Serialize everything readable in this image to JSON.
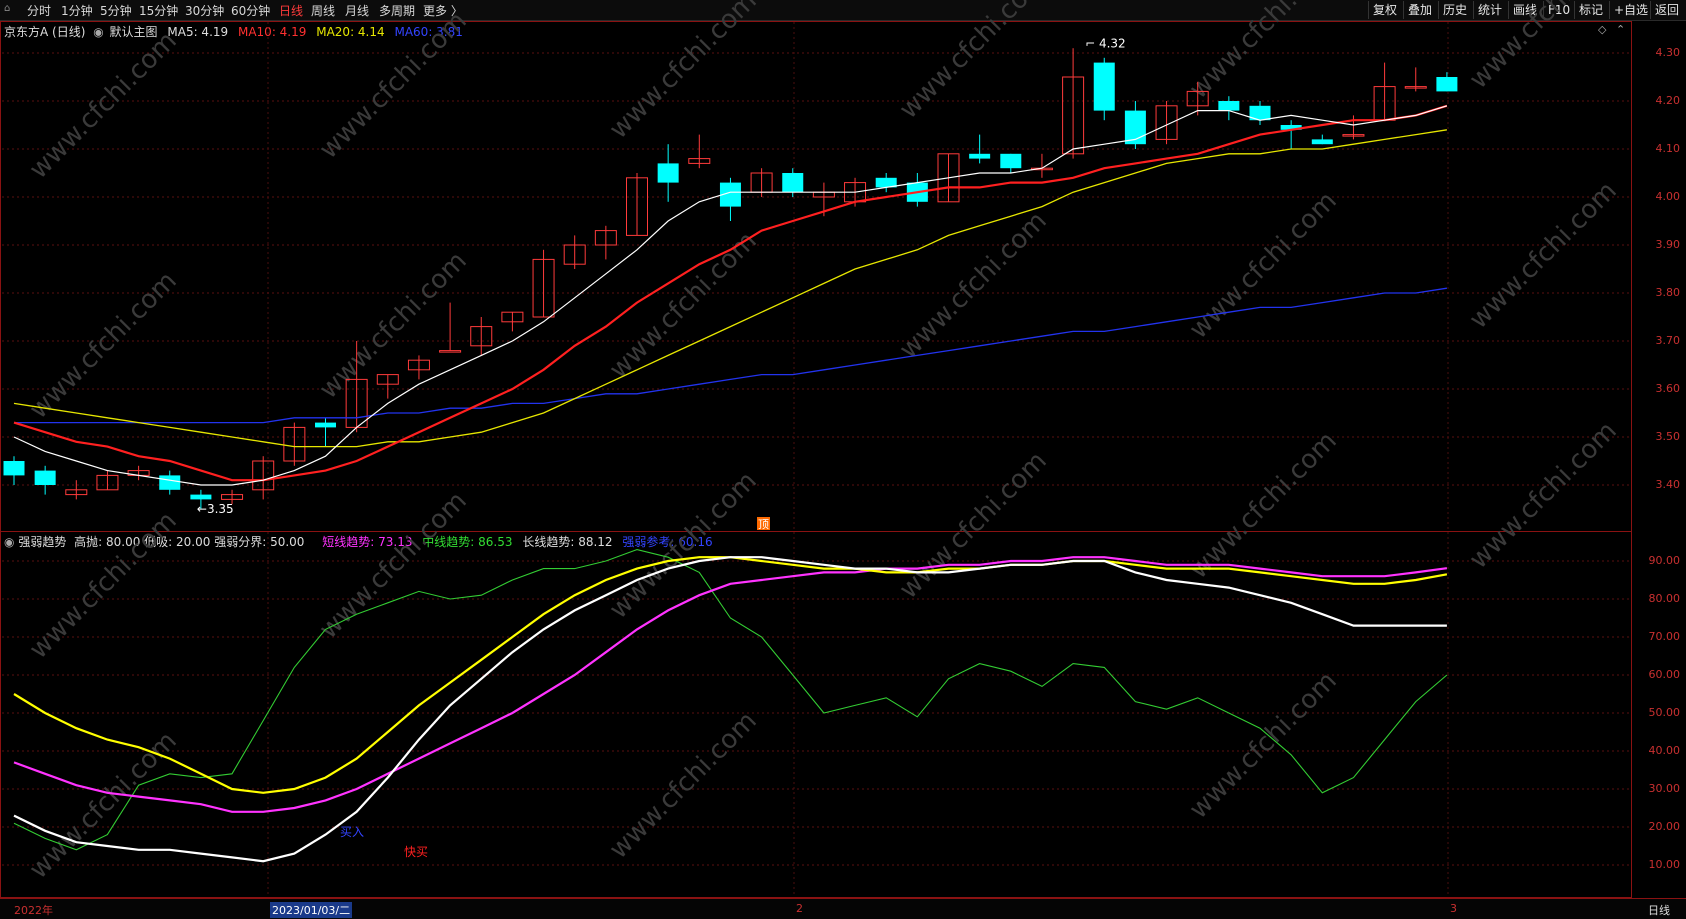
{
  "toolbar": {
    "periods": [
      "分时",
      "1分钟",
      "5分钟",
      "15分钟",
      "30分钟",
      "60分钟",
      "日线",
      "周线",
      "月线",
      "多周期",
      "更多 〉"
    ],
    "active_period": "日线",
    "right_buttons": [
      "复权",
      "叠加",
      "历史",
      "统计",
      "画线",
      "F10",
      "标记",
      "+自选",
      "返回"
    ]
  },
  "price_info": {
    "stock_name": "京东方A (日线)",
    "chart_name": "默认主图",
    "ma5": "MA5: 4.19",
    "ma10": "MA10: 4.19",
    "ma20": "MA20: 4.14",
    "ma60": "MA60: 3.81"
  },
  "indicator_info": {
    "name": "强弱趋势",
    "params": "高抛: 80.00  低吸: 20.00  强弱分界: 50.00",
    "short": "短线趋势: 73.13",
    "mid": "中线趋势: 86.53",
    "long": "长线趋势: 88.12",
    "ref": "强弱参考: 60.16"
  },
  "annotations": {
    "high": "4.32",
    "low": "3.35",
    "buy1": "买入",
    "buy2": "快买",
    "top_mark": "顶"
  },
  "watermark": "www.cfchi.com",
  "price_axis": [
    "4.30",
    "4.20",
    "4.10",
    "4.00",
    "3.90",
    "3.80",
    "3.70",
    "3.60",
    "3.50",
    "3.40"
  ],
  "ind_axis": [
    "90.00",
    "80.00",
    "70.00",
    "60.00",
    "50.00",
    "40.00",
    "30.00",
    "20.00",
    "10.00"
  ],
  "time_axis": {
    "start": "2022年",
    "cursor": "2023/01/03/二",
    "m2": "2",
    "m3": "3",
    "period": "日线"
  },
  "colors": {
    "up": "#ff3b3b",
    "down": "#00ffff",
    "ma5": "#ffffff",
    "ma10": "#ff2020",
    "ma20": "#e6e600",
    "ma60": "#2233ee",
    "short": "#ffffff",
    "mid": "#ffff00",
    "long": "#ff33ff",
    "ref": "#33cc33"
  },
  "chart_data": {
    "type": "candlestick",
    "candles": [
      {
        "o": 3.45,
        "h": 3.46,
        "l": 3.4,
        "c": 3.42
      },
      {
        "o": 3.43,
        "h": 3.44,
        "l": 3.38,
        "c": 3.4
      },
      {
        "o": 3.38,
        "h": 3.41,
        "l": 3.37,
        "c": 3.39
      },
      {
        "o": 3.39,
        "h": 3.43,
        "l": 3.39,
        "c": 3.42
      },
      {
        "o": 3.42,
        "h": 3.44,
        "l": 3.41,
        "c": 3.43
      },
      {
        "o": 3.42,
        "h": 3.43,
        "l": 3.38,
        "c": 3.39
      },
      {
        "o": 3.38,
        "h": 3.39,
        "l": 3.35,
        "c": 3.37
      },
      {
        "o": 3.37,
        "h": 3.39,
        "l": 3.36,
        "c": 3.38
      },
      {
        "o": 3.39,
        "h": 3.46,
        "l": 3.37,
        "c": 3.45
      },
      {
        "o": 3.45,
        "h": 3.53,
        "l": 3.44,
        "c": 3.52
      },
      {
        "o": 3.53,
        "h": 3.54,
        "l": 3.48,
        "c": 3.52
      },
      {
        "o": 3.52,
        "h": 3.7,
        "l": 3.51,
        "c": 3.62
      },
      {
        "o": 3.61,
        "h": 3.63,
        "l": 3.58,
        "c": 3.63
      },
      {
        "o": 3.64,
        "h": 3.67,
        "l": 3.62,
        "c": 3.66
      },
      {
        "o": 3.68,
        "h": 3.78,
        "l": 3.68,
        "c": 3.68
      },
      {
        "o": 3.69,
        "h": 3.75,
        "l": 3.67,
        "c": 3.73
      },
      {
        "o": 3.74,
        "h": 3.76,
        "l": 3.72,
        "c": 3.76
      },
      {
        "o": 3.75,
        "h": 3.89,
        "l": 3.75,
        "c": 3.87
      },
      {
        "o": 3.86,
        "h": 3.92,
        "l": 3.85,
        "c": 3.9
      },
      {
        "o": 3.9,
        "h": 3.94,
        "l": 3.87,
        "c": 3.93
      },
      {
        "o": 3.92,
        "h": 4.05,
        "l": 3.92,
        "c": 4.04
      },
      {
        "o": 4.07,
        "h": 4.11,
        "l": 3.99,
        "c": 4.03
      },
      {
        "o": 4.07,
        "h": 4.13,
        "l": 4.06,
        "c": 4.08
      },
      {
        "o": 4.03,
        "h": 4.04,
        "l": 3.95,
        "c": 3.98
      },
      {
        "o": 4.01,
        "h": 4.06,
        "l": 4.0,
        "c": 4.05
      },
      {
        "o": 4.05,
        "h": 4.06,
        "l": 4.0,
        "c": 4.01
      },
      {
        "o": 4.0,
        "h": 4.03,
        "l": 3.96,
        "c": 4.01
      },
      {
        "o": 3.99,
        "h": 4.04,
        "l": 3.98,
        "c": 4.03
      },
      {
        "o": 4.04,
        "h": 4.05,
        "l": 4.01,
        "c": 4.02
      },
      {
        "o": 4.03,
        "h": 4.05,
        "l": 3.98,
        "c": 3.99
      },
      {
        "o": 3.99,
        "h": 4.09,
        "l": 3.99,
        "c": 4.09
      },
      {
        "o": 4.09,
        "h": 4.13,
        "l": 4.07,
        "c": 4.08
      },
      {
        "o": 4.09,
        "h": 4.09,
        "l": 4.05,
        "c": 4.06
      },
      {
        "o": 4.06,
        "h": 4.09,
        "l": 4.04,
        "c": 4.06
      },
      {
        "o": 4.09,
        "h": 4.31,
        "l": 4.08,
        "c": 4.25
      },
      {
        "o": 4.28,
        "h": 4.29,
        "l": 4.16,
        "c": 4.18
      },
      {
        "o": 4.18,
        "h": 4.2,
        "l": 4.1,
        "c": 4.11
      },
      {
        "o": 4.12,
        "h": 4.2,
        "l": 4.11,
        "c": 4.19
      },
      {
        "o": 4.19,
        "h": 4.24,
        "l": 4.17,
        "c": 4.22
      },
      {
        "o": 4.2,
        "h": 4.21,
        "l": 4.16,
        "c": 4.18
      },
      {
        "o": 4.19,
        "h": 4.2,
        "l": 4.15,
        "c": 4.16
      },
      {
        "o": 4.15,
        "h": 4.16,
        "l": 4.1,
        "c": 4.14
      },
      {
        "o": 4.12,
        "h": 4.13,
        "l": 4.11,
        "c": 4.11
      },
      {
        "o": 4.13,
        "h": 4.17,
        "l": 4.12,
        "c": 4.13
      },
      {
        "o": 4.16,
        "h": 4.28,
        "l": 4.16,
        "c": 4.23
      },
      {
        "o": 4.23,
        "h": 4.27,
        "l": 4.22,
        "c": 4.23
      },
      {
        "o": 4.25,
        "h": 4.26,
        "l": 4.22,
        "c": 4.22
      }
    ],
    "ma5": [
      3.5,
      3.47,
      3.45,
      3.43,
      3.42,
      3.41,
      3.4,
      3.4,
      3.41,
      3.43,
      3.46,
      3.52,
      3.57,
      3.61,
      3.64,
      3.67,
      3.7,
      3.74,
      3.79,
      3.84,
      3.89,
      3.95,
      3.99,
      4.01,
      4.01,
      4.01,
      4.01,
      4.01,
      4.02,
      4.03,
      4.04,
      4.05,
      4.05,
      4.06,
      4.1,
      4.11,
      4.12,
      4.15,
      4.18,
      4.18,
      4.16,
      4.17,
      4.16,
      4.15,
      4.16,
      4.17,
      4.19
    ],
    "ma10": [
      3.53,
      3.51,
      3.49,
      3.48,
      3.46,
      3.45,
      3.43,
      3.41,
      3.41,
      3.42,
      3.43,
      3.45,
      3.48,
      3.51,
      3.54,
      3.57,
      3.6,
      3.64,
      3.69,
      3.73,
      3.78,
      3.82,
      3.86,
      3.89,
      3.93,
      3.95,
      3.97,
      3.99,
      4.0,
      4.01,
      4.02,
      4.02,
      4.03,
      4.03,
      4.04,
      4.06,
      4.07,
      4.08,
      4.09,
      4.11,
      4.13,
      4.14,
      4.15,
      4.16,
      4.16,
      4.17,
      4.19
    ],
    "ma20": [
      3.57,
      3.56,
      3.55,
      3.54,
      3.53,
      3.52,
      3.51,
      3.5,
      3.49,
      3.48,
      3.48,
      3.48,
      3.49,
      3.49,
      3.5,
      3.51,
      3.53,
      3.55,
      3.58,
      3.61,
      3.64,
      3.67,
      3.7,
      3.73,
      3.76,
      3.79,
      3.82,
      3.85,
      3.87,
      3.89,
      3.92,
      3.94,
      3.96,
      3.98,
      4.01,
      4.03,
      4.05,
      4.07,
      4.08,
      4.09,
      4.09,
      4.1,
      4.1,
      4.11,
      4.12,
      4.13,
      4.14
    ],
    "ma60": [
      3.53,
      3.53,
      3.53,
      3.53,
      3.53,
      3.53,
      3.53,
      3.53,
      3.53,
      3.54,
      3.54,
      3.54,
      3.55,
      3.55,
      3.56,
      3.56,
      3.57,
      3.57,
      3.58,
      3.59,
      3.59,
      3.6,
      3.61,
      3.62,
      3.63,
      3.63,
      3.64,
      3.65,
      3.66,
      3.67,
      3.68,
      3.69,
      3.7,
      3.71,
      3.72,
      3.72,
      3.73,
      3.74,
      3.75,
      3.76,
      3.77,
      3.77,
      3.78,
      3.79,
      3.8,
      3.8,
      3.81
    ],
    "short_trend": [
      23,
      19,
      16,
      15,
      14,
      14,
      13,
      12,
      11,
      13,
      18,
      24,
      33,
      43,
      52,
      59,
      66,
      72,
      77,
      81,
      85,
      88,
      90,
      91,
      91,
      90,
      89,
      88,
      88,
      87,
      87,
      88,
      89,
      89,
      90,
      90,
      87,
      85,
      84,
      83,
      81,
      79,
      76,
      73,
      73,
      73,
      73
    ],
    "mid_trend": [
      55,
      50,
      46,
      43,
      41,
      38,
      34,
      30,
      29,
      30,
      33,
      38,
      45,
      52,
      58,
      64,
      70,
      76,
      81,
      85,
      88,
      90,
      91,
      91,
      90,
      89,
      88,
      88,
      87,
      87,
      88,
      88,
      89,
      89,
      90,
      90,
      89,
      88,
      88,
      88,
      87,
      86,
      85,
      84,
      84,
      85,
      86.5
    ],
    "long_trend": [
      37,
      34,
      31,
      29,
      28,
      27,
      26,
      24,
      24,
      25,
      27,
      30,
      34,
      38,
      42,
      46,
      50,
      55,
      60,
      66,
      72,
      77,
      81,
      84,
      85,
      86,
      87,
      87,
      88,
      88,
      89,
      89,
      90,
      90,
      91,
      91,
      90,
      89,
      89,
      89,
      88,
      87,
      86,
      86,
      86,
      87,
      88.1
    ],
    "ref_trend": [
      21,
      17,
      14,
      18,
      31,
      34,
      33,
      34,
      48,
      62,
      72,
      76,
      79,
      82,
      80,
      81,
      85,
      88,
      88,
      90,
      93,
      91,
      87,
      75,
      70,
      60,
      50,
      52,
      54,
      49,
      59,
      63,
      61,
      57,
      63,
      62,
      53,
      51,
      54,
      50,
      46,
      39,
      29,
      33,
      43,
      53,
      60
    ]
  }
}
